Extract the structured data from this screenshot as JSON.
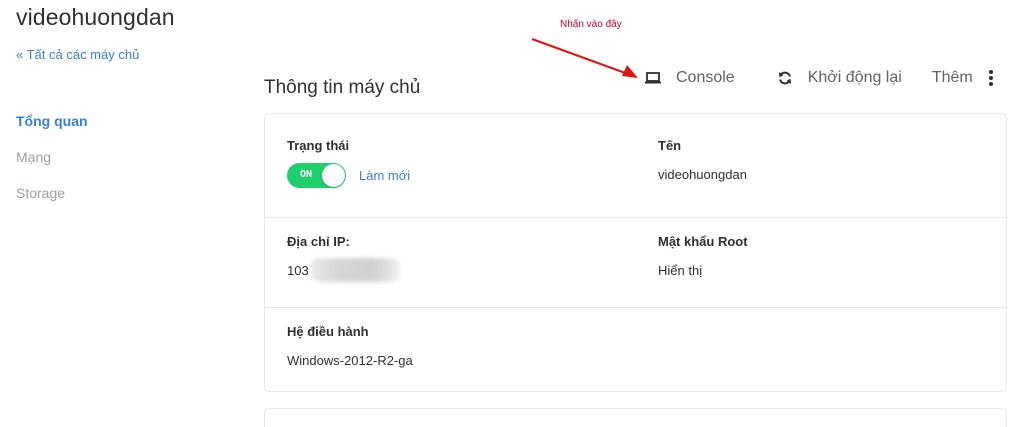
{
  "header": {
    "title": "videohuongdan",
    "back_link": "« Tất cả các máy chủ"
  },
  "sidebar": {
    "items": [
      {
        "label": "Tổng quan",
        "active": true
      },
      {
        "label": "Mạng",
        "active": false
      },
      {
        "label": "Storage",
        "active": false
      }
    ]
  },
  "main": {
    "section_title": "Thông tin máy chủ"
  },
  "annotation": {
    "text": "Nhấn vào đây",
    "color": "#d0021b"
  },
  "toolbar": {
    "console_label": "Console",
    "console_icon": "laptop-icon",
    "restart_label": "Khởi động lại",
    "restart_icon": "refresh-icon",
    "more_label": "Thêm",
    "more_icon": "kebab-menu-icon"
  },
  "info": {
    "status_label": "Trạng thái",
    "status_toggle": "ON",
    "refresh_label": "Làm mới",
    "name_label": "Tên",
    "name_value": "videohuongdan",
    "ip_label": "Địa chỉ IP:",
    "ip_value_visible": "103",
    "root_label": "Mật khẩu Root",
    "root_action": "Hiển thị",
    "os_label": "Hệ điều hành",
    "os_value": "Windows-2012-R2-ga"
  },
  "colors": {
    "accent": "#3d7dd6",
    "toggle_on": "#1fce6d",
    "danger": "#d0021b"
  }
}
